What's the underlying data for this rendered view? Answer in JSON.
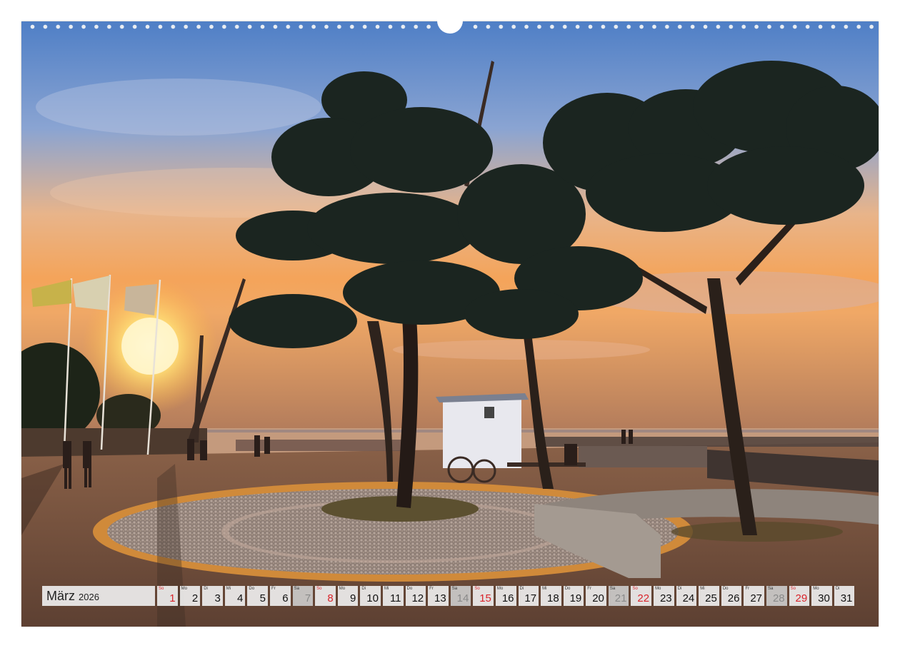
{
  "calendar": {
    "month": "März",
    "year": "2026",
    "days": [
      {
        "wd": "So",
        "num": "1",
        "type": "sun"
      },
      {
        "wd": "Mo",
        "num": "2",
        "type": "week"
      },
      {
        "wd": "Di",
        "num": "3",
        "type": "week"
      },
      {
        "wd": "Mi",
        "num": "4",
        "type": "week"
      },
      {
        "wd": "Do",
        "num": "5",
        "type": "week"
      },
      {
        "wd": "Fr",
        "num": "6",
        "type": "week"
      },
      {
        "wd": "Sa",
        "num": "7",
        "type": "sat"
      },
      {
        "wd": "So",
        "num": "8",
        "type": "sun"
      },
      {
        "wd": "Mo",
        "num": "9",
        "type": "week"
      },
      {
        "wd": "Di",
        "num": "10",
        "type": "week"
      },
      {
        "wd": "Mi",
        "num": "11",
        "type": "week"
      },
      {
        "wd": "Do",
        "num": "12",
        "type": "week"
      },
      {
        "wd": "Fr",
        "num": "13",
        "type": "week"
      },
      {
        "wd": "Sa",
        "num": "14",
        "type": "sat"
      },
      {
        "wd": "So",
        "num": "15",
        "type": "sun"
      },
      {
        "wd": "Mo",
        "num": "16",
        "type": "week"
      },
      {
        "wd": "Di",
        "num": "17",
        "type": "week"
      },
      {
        "wd": "Mi",
        "num": "18",
        "type": "week"
      },
      {
        "wd": "Do",
        "num": "19",
        "type": "week"
      },
      {
        "wd": "Fr",
        "num": "20",
        "type": "week"
      },
      {
        "wd": "Sa",
        "num": "21",
        "type": "sat"
      },
      {
        "wd": "So",
        "num": "22",
        "type": "sun"
      },
      {
        "wd": "Mo",
        "num": "23",
        "type": "week"
      },
      {
        "wd": "Di",
        "num": "24",
        "type": "week"
      },
      {
        "wd": "Mi",
        "num": "25",
        "type": "week"
      },
      {
        "wd": "Do",
        "num": "26",
        "type": "week"
      },
      {
        "wd": "Fr",
        "num": "27",
        "type": "week"
      },
      {
        "wd": "Sa",
        "num": "28",
        "type": "sat"
      },
      {
        "wd": "So",
        "num": "29",
        "type": "sun"
      },
      {
        "wd": "Mo",
        "num": "30",
        "type": "week"
      },
      {
        "wd": "Di",
        "num": "31",
        "type": "week"
      }
    ]
  },
  "colors": {
    "sunday": "#d9242b",
    "saturday_text": "#8a8a8a",
    "cell_bg": "#eeeeee"
  },
  "photo": {
    "icon": "seaside-promenade-photo"
  }
}
